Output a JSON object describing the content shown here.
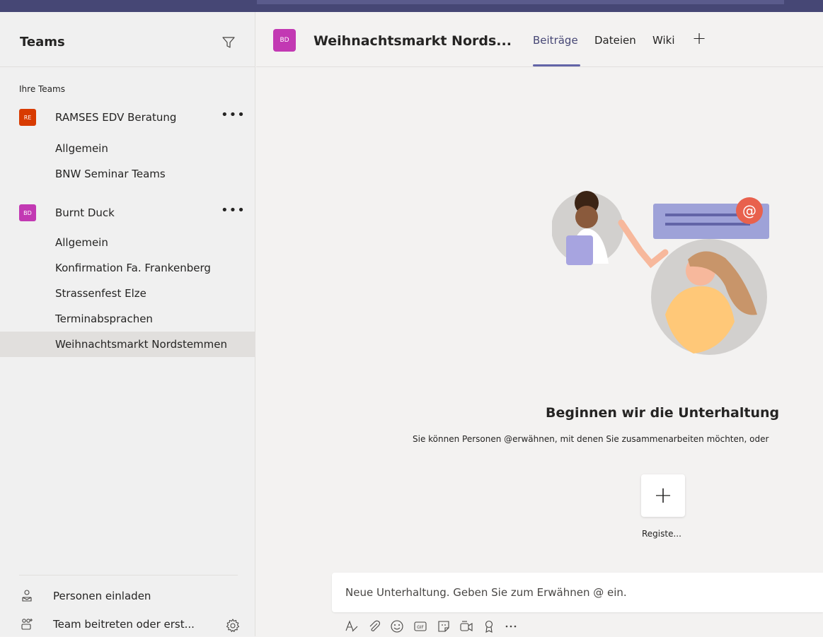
{
  "sidebar": {
    "title": "Teams",
    "section_label": "Ihre Teams",
    "teams": [
      {
        "avatar": "RE",
        "avatar_color": "#d83b01",
        "name": "RAMSES EDV Beratung",
        "more": "•••",
        "channels": [
          "Allgemein",
          "BNW Seminar Teams"
        ]
      },
      {
        "avatar": "BD",
        "avatar_color": "#c239b3",
        "name": "Burnt Duck",
        "more": "•••",
        "channels": [
          "Allgemein",
          "Konfirmation Fa. Frankenberg",
          "Strassenfest Elze",
          "Terminabsprachen",
          "Weihnachtsmarkt Nordstemmen"
        ]
      }
    ],
    "active_channel": "Weihnachtsmarkt Nordstemmen",
    "invite_label": "Personen einladen",
    "join_label": "Team beitreten oder erst..."
  },
  "main": {
    "avatar": "BD",
    "title": "Weihnachtsmarkt Nords...",
    "tabs": [
      "Beiträge",
      "Dateien",
      "Wiki"
    ],
    "active_tab": "Beiträge",
    "add_tab": "+",
    "empty_title": "Beginnen wir die Unterhaltung",
    "empty_subtitle": "Sie können Personen @erwähnen, mit denen Sie zusammenarbeiten möchten, oder",
    "register_plus": "+",
    "register_label": "Registe...",
    "compose_placeholder": "Neue Unterhaltung. Geben Sie zum Erwähnen @ ein.",
    "toolbar_icons": [
      "format-icon",
      "attach-icon",
      "emoji-icon",
      "gif-icon",
      "sticker-icon",
      "meet-icon",
      "praise-icon",
      "more-icon"
    ]
  },
  "colors": {
    "accent": "#6264a7",
    "topbar": "#464775"
  }
}
